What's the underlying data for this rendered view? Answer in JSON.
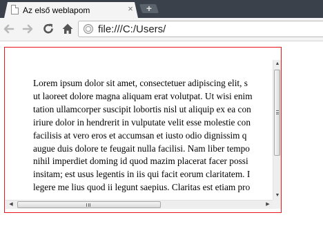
{
  "tab": {
    "title": "Az első weblapom",
    "close_symbol": "×",
    "new_tab_symbol": "+"
  },
  "toolbar": {
    "back_icon": "back-arrow-icon",
    "forward_icon": "forward-arrow-icon",
    "reload_icon": "reload-icon",
    "home_icon": "home-icon",
    "address": "file:///C:/Users/"
  },
  "content": {
    "lines": [
      "Lorem ipsum dolor sit amet, consectetuer adipiscing elit, s",
      "ut laoreet dolore magna aliquam erat volutpat. Ut wisi enim",
      "tation ullamcorper suscipit lobortis nisl ut aliquip ex ea con",
      "iriure dolor in hendrerit in vulputate velit esse molestie con",
      "facilisis at vero eros et accumsan et iusto odio dignissim q",
      "augue duis dolore te feugait nulla facilisi. Nam liber tempo",
      "nihil imperdiet doming id quod mazim placerat facer possi",
      "insitam; est usus legentis in iis qui facit eorum claritatem. I",
      "legere me lius quod ii legunt saepius. Claritas est etiam pro"
    ]
  },
  "colors": {
    "frame_border": "#e8141c",
    "tabstrip": "#3a414a"
  }
}
